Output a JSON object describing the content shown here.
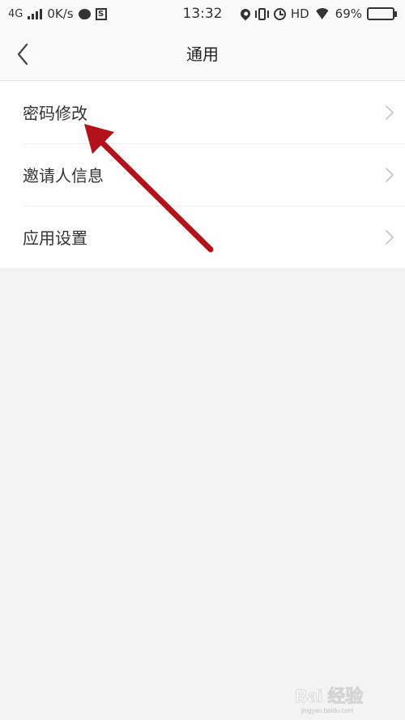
{
  "status_bar": {
    "network": "4G",
    "speed": "0K/s",
    "time": "13:32",
    "hd": "HD",
    "battery_percent": "69%",
    "battery_level": 0.69,
    "icons": [
      "signal-icon",
      "chat-icon",
      "s-box-icon",
      "location-icon",
      "vibrate-icon",
      "alarm-icon",
      "wifi-icon",
      "battery-icon"
    ]
  },
  "header": {
    "title": "通用",
    "back_icon": "chevron-left-icon"
  },
  "menu": {
    "items": [
      {
        "label": "密码修改",
        "icon": "chevron-right-icon"
      },
      {
        "label": "邀请人信息",
        "icon": "chevron-right-icon"
      },
      {
        "label": "应用设置",
        "icon": "chevron-right-icon"
      }
    ]
  },
  "annotation": {
    "color": "#b3121b"
  },
  "watermark": {
    "text": "Bai 经验",
    "subtext": "jingyan.baidu.com"
  }
}
